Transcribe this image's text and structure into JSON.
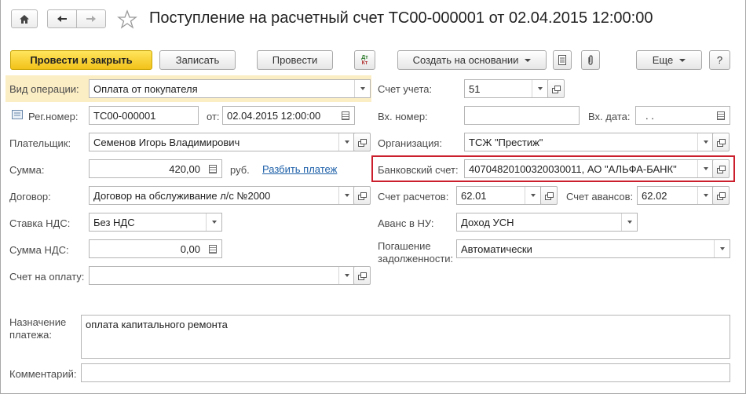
{
  "window": {
    "title": "Поступление на расчетный счет ТС00-000001 от 02.04.2015 12:00:00"
  },
  "toolbar": {
    "post_close": "Провести и закрыть",
    "save": "Записать",
    "post": "Провести",
    "dtkt": "Дт Кт",
    "create_based": "Создать на основании",
    "more": "Еще",
    "help": "?"
  },
  "form": {
    "operation_type": {
      "label": "Вид операции:",
      "value": "Оплата от покупателя"
    },
    "reg_number": {
      "label": "Рег.номер:",
      "value": "ТС00-000001"
    },
    "date": {
      "label": "от:",
      "value": "02.04.2015 12:00:00"
    },
    "payer": {
      "label": "Плательщик:",
      "value": "Семенов Игорь Владимирович"
    },
    "amount": {
      "label": "Сумма:",
      "value": "420,00",
      "currency": "руб.",
      "split_link": "Разбить платеж"
    },
    "contract": {
      "label": "Договор:",
      "value": "Договор на обслуживание л/с №2000"
    },
    "vat_rate": {
      "label": "Ставка НДС:",
      "value": "Без НДС"
    },
    "vat_amount": {
      "label": "Сумма НДС:",
      "value": "0,00"
    },
    "invoice": {
      "label": "Счет на оплату:",
      "value": ""
    },
    "account": {
      "label": "Счет учета:",
      "value": "51"
    },
    "in_number": {
      "label": "Вх. номер:",
      "value": ""
    },
    "in_date": {
      "label": "Вх. дата:",
      "value": ". ."
    },
    "organization": {
      "label": "Организация:",
      "value": "ТСЖ \"Престиж\""
    },
    "bank_account": {
      "label": "Банковский счет:",
      "value": "40704820100320030011, АО \"АЛЬФА-БАНК\""
    },
    "settlement_account": {
      "label": "Счет расчетов:",
      "value": "62.01"
    },
    "advance_account": {
      "label": "Счет авансов:",
      "value": "62.02"
    },
    "advance_tax": {
      "label": "Аванс в НУ:",
      "value": "Доход УСН"
    },
    "debt_repayment": {
      "label_line1": "Погашение",
      "label_line2": "задолженности:",
      "value": "Автоматически"
    },
    "purpose": {
      "label_line1": "Назначение",
      "label_line2": "платежа:",
      "value": "оплата капитального ремонта"
    },
    "comment": {
      "label": "Комментарий:",
      "value": ""
    }
  },
  "colors": {
    "primary_button": "#f2c21a",
    "highlight_row": "#fbedc4",
    "red_frame": "#cc1f2d",
    "link": "#1c5fa8"
  }
}
